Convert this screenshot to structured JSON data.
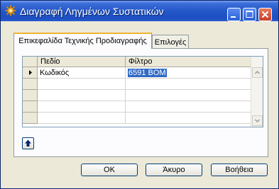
{
  "window": {
    "title": "Διαγραφή Ληγμένων Συστατικών",
    "icon": "gear-icon"
  },
  "titlebar_buttons": {
    "minimize": "minimize-icon",
    "maximize": "maximize-icon",
    "close": "close-icon"
  },
  "tabs": [
    {
      "label": "Επικεφαλίδα Τεχνικής Προδιαγραφής",
      "active": true
    },
    {
      "label": "Επιλογές",
      "active": false
    }
  ],
  "grid": {
    "columns": [
      "Πεδίο",
      "Φίλτρο"
    ],
    "rows": [
      {
        "field": "Κωδικός",
        "filter": "6591 BOM"
      },
      {
        "field": "",
        "filter": ""
      },
      {
        "field": "",
        "filter": ""
      },
      {
        "field": "",
        "filter": ""
      },
      {
        "field": "",
        "filter": ""
      }
    ]
  },
  "buttons": {
    "ok": "OK",
    "cancel": "Άκυρο",
    "help": "Βοήθεια"
  },
  "colors": {
    "titlebar": "#2457c8",
    "selection": "#316ac5",
    "tab_highlight": "#f0b433"
  }
}
